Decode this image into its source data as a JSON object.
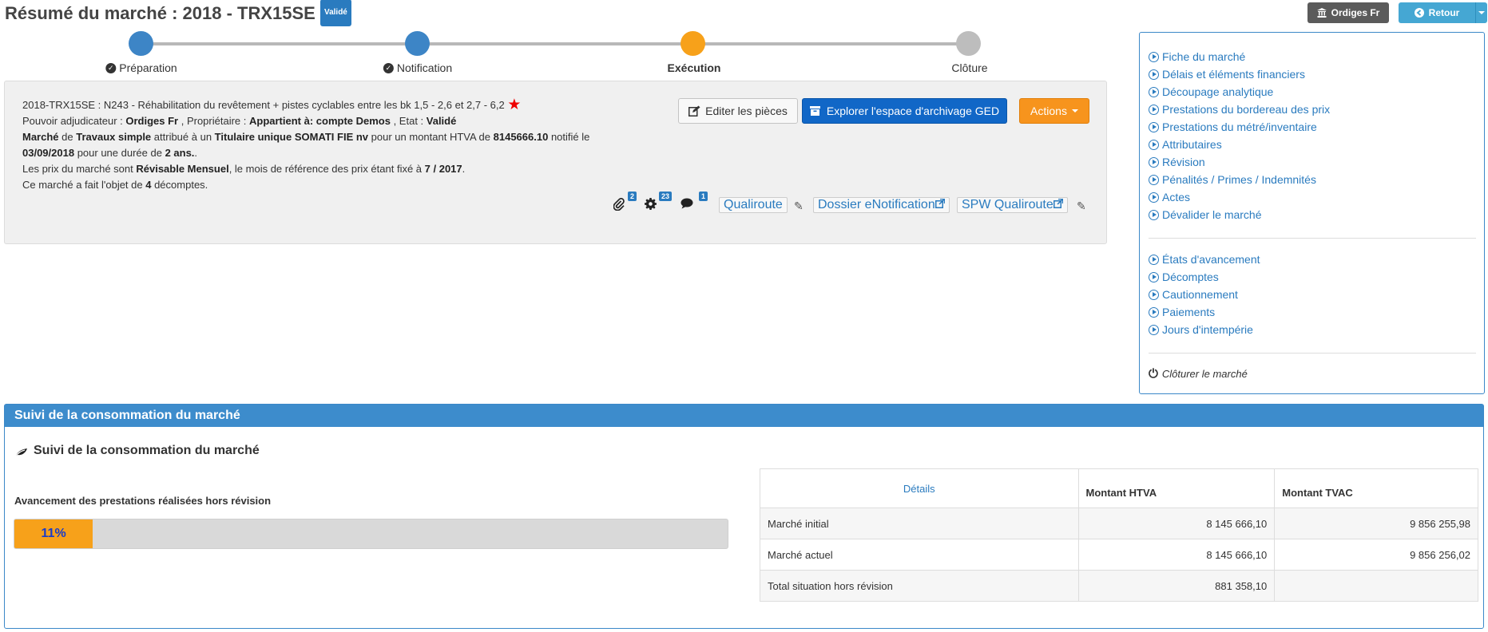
{
  "header": {
    "title": "Résumé du marché : 2018 - TRX15SE",
    "status_badge": "Validé",
    "org_button": "Ordiges Fr",
    "back_button": "Retour"
  },
  "stepper": {
    "steps": [
      {
        "label": "Préparation",
        "state": "done",
        "color": "#3d85c6"
      },
      {
        "label": "Notification",
        "state": "done",
        "color": "#3d85c6"
      },
      {
        "label": "Exécution",
        "state": "current",
        "color": "#f7a11a"
      },
      {
        "label": "Clôture",
        "state": "pending",
        "color": "#bdbdbd"
      }
    ]
  },
  "info": {
    "line1": "2018-TRX15SE : N243 - Réhabilitation du revêtement + pistes cyclables entre les bk 1,5 - 2,6 et 2,7 - 6,2",
    "pouvoir_label": "Pouvoir adjudicateur : ",
    "pouvoir_value": "Ordiges Fr",
    "proprietaire_label": " , Propriétaire : ",
    "proprietaire_value": "Appartient à: compte Demos",
    "etat_label": " , Etat : ",
    "etat_value": "Validé",
    "marche_label": "Marché",
    "de_text": " de ",
    "type_value": "Travaux simple",
    "attribue_text": " attribué à un ",
    "titulaire_value": "Titulaire unique SOMATI FIE nv",
    "montant_text": " pour un montant HTVA de ",
    "montant_value": "8145666.10",
    "notifie_text": " notifié le",
    "date_value": "03/09/2018",
    "duree_text": " pour une durée de ",
    "duree_value": "2 ans.",
    "duree_end": ".",
    "prix_text": "Les prix du marché sont ",
    "prix_value": "Révisable Mensuel",
    "ref_text": ", le mois de référence des prix étant fixé à ",
    "ref_value": "7 / 2017",
    "ref_end": ".",
    "decomptes_text": "Ce marché a fait l'objet de ",
    "decomptes_value": "4",
    "decomptes_end": " décomptes."
  },
  "buttons": {
    "edit": "Editer les pièces",
    "ged": "Explorer l'espace d'archivage GED",
    "actions": "Actions"
  },
  "tools": {
    "attachments_count": "2",
    "settings_count": "23",
    "comments_count": "1",
    "link1": "Qualiroute",
    "link2": "Dossier eNotification",
    "link3": "SPW Qualiroute"
  },
  "sidebar": {
    "group1": [
      "Fiche du marché",
      "Délais et éléments financiers",
      "Découpage analytique",
      "Prestations du bordereau des prix",
      "Prestations du métré/inventaire",
      "Attributaires",
      "Révision",
      "Pénalités / Primes / Indemnités",
      "Actes",
      "Dévalider le marché"
    ],
    "group2": [
      "États d'avancement",
      "Décomptes",
      "Cautionnement",
      "Paiements",
      "Jours d'intempérie"
    ],
    "close": "Clôturer le marché"
  },
  "consumption": {
    "panel_header": "Suivi de la consommation du marché",
    "title": "Suivi de la consommation du marché",
    "progress_label": "Avancement des prestations réalisées hors révision",
    "progress_percent": 11,
    "progress_text": "11%",
    "table": {
      "headers": [
        "Détails",
        "Montant HTVA",
        "Montant TVAC"
      ],
      "rows": [
        [
          "Marché initial",
          "8 145 666,10",
          "9 856 255,98"
        ],
        [
          "Marché actuel",
          "8 145 666,10",
          "9 856 256,02"
        ],
        [
          "Total situation hors révision",
          "881 358,10",
          ""
        ]
      ]
    }
  }
}
